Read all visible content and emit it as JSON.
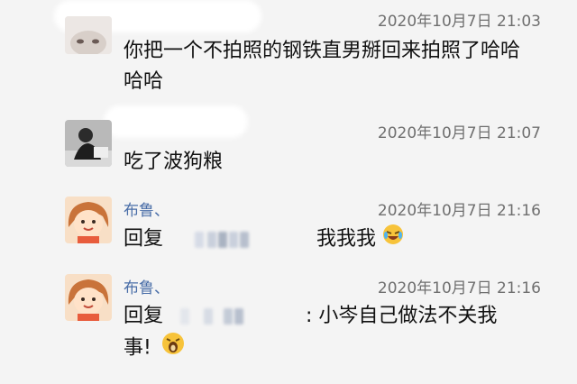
{
  "messages": [
    {
      "name": "",
      "time": "2020年10月7日 21:03",
      "text": "你把一个不拍照的钢铁直男掰回来拍照了哈哈哈哈"
    },
    {
      "name": "",
      "time": "2020年10月7日 21:07",
      "text": "吃了波狗粮"
    },
    {
      "name": "布鲁、",
      "time": "2020年10月7日 21:16",
      "reply_prefix": "回复",
      "text": "我我我"
    },
    {
      "name": "布鲁、",
      "time": "2020年10月7日 21:16",
      "reply_prefix": "回复",
      "text": ": 小岑自己做法不关我事!"
    }
  ],
  "icons": {
    "laugh_cry": "laugh-cry-emoji-icon",
    "shocked": "shocked-face-emoji-icon"
  }
}
